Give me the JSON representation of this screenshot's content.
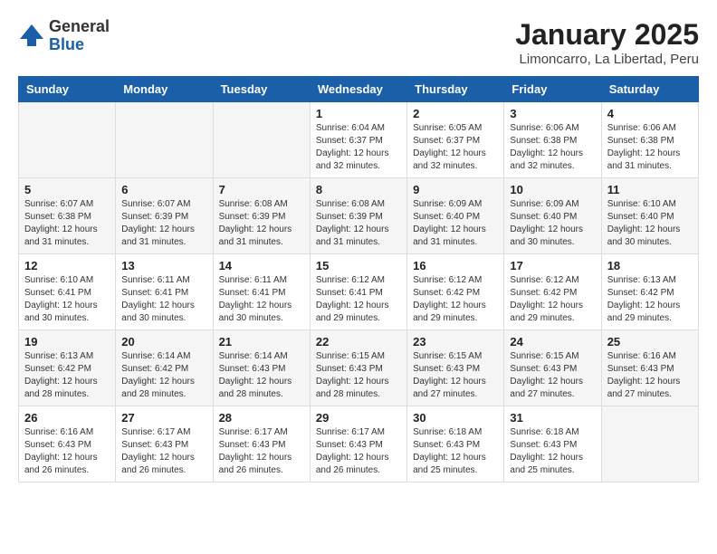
{
  "logo": {
    "general": "General",
    "blue": "Blue"
  },
  "title": "January 2025",
  "subtitle": "Limoncarro, La Libertad, Peru",
  "days": [
    "Sunday",
    "Monday",
    "Tuesday",
    "Wednesday",
    "Thursday",
    "Friday",
    "Saturday"
  ],
  "weeks": [
    [
      {
        "num": "",
        "info": ""
      },
      {
        "num": "",
        "info": ""
      },
      {
        "num": "",
        "info": ""
      },
      {
        "num": "1",
        "info": "Sunrise: 6:04 AM\nSunset: 6:37 PM\nDaylight: 12 hours\nand 32 minutes."
      },
      {
        "num": "2",
        "info": "Sunrise: 6:05 AM\nSunset: 6:37 PM\nDaylight: 12 hours\nand 32 minutes."
      },
      {
        "num": "3",
        "info": "Sunrise: 6:06 AM\nSunset: 6:38 PM\nDaylight: 12 hours\nand 32 minutes."
      },
      {
        "num": "4",
        "info": "Sunrise: 6:06 AM\nSunset: 6:38 PM\nDaylight: 12 hours\nand 31 minutes."
      }
    ],
    [
      {
        "num": "5",
        "info": "Sunrise: 6:07 AM\nSunset: 6:38 PM\nDaylight: 12 hours\nand 31 minutes."
      },
      {
        "num": "6",
        "info": "Sunrise: 6:07 AM\nSunset: 6:39 PM\nDaylight: 12 hours\nand 31 minutes."
      },
      {
        "num": "7",
        "info": "Sunrise: 6:08 AM\nSunset: 6:39 PM\nDaylight: 12 hours\nand 31 minutes."
      },
      {
        "num": "8",
        "info": "Sunrise: 6:08 AM\nSunset: 6:39 PM\nDaylight: 12 hours\nand 31 minutes."
      },
      {
        "num": "9",
        "info": "Sunrise: 6:09 AM\nSunset: 6:40 PM\nDaylight: 12 hours\nand 31 minutes."
      },
      {
        "num": "10",
        "info": "Sunrise: 6:09 AM\nSunset: 6:40 PM\nDaylight: 12 hours\nand 30 minutes."
      },
      {
        "num": "11",
        "info": "Sunrise: 6:10 AM\nSunset: 6:40 PM\nDaylight: 12 hours\nand 30 minutes."
      }
    ],
    [
      {
        "num": "12",
        "info": "Sunrise: 6:10 AM\nSunset: 6:41 PM\nDaylight: 12 hours\nand 30 minutes."
      },
      {
        "num": "13",
        "info": "Sunrise: 6:11 AM\nSunset: 6:41 PM\nDaylight: 12 hours\nand 30 minutes."
      },
      {
        "num": "14",
        "info": "Sunrise: 6:11 AM\nSunset: 6:41 PM\nDaylight: 12 hours\nand 30 minutes."
      },
      {
        "num": "15",
        "info": "Sunrise: 6:12 AM\nSunset: 6:41 PM\nDaylight: 12 hours\nand 29 minutes."
      },
      {
        "num": "16",
        "info": "Sunrise: 6:12 AM\nSunset: 6:42 PM\nDaylight: 12 hours\nand 29 minutes."
      },
      {
        "num": "17",
        "info": "Sunrise: 6:12 AM\nSunset: 6:42 PM\nDaylight: 12 hours\nand 29 minutes."
      },
      {
        "num": "18",
        "info": "Sunrise: 6:13 AM\nSunset: 6:42 PM\nDaylight: 12 hours\nand 29 minutes."
      }
    ],
    [
      {
        "num": "19",
        "info": "Sunrise: 6:13 AM\nSunset: 6:42 PM\nDaylight: 12 hours\nand 28 minutes."
      },
      {
        "num": "20",
        "info": "Sunrise: 6:14 AM\nSunset: 6:42 PM\nDaylight: 12 hours\nand 28 minutes."
      },
      {
        "num": "21",
        "info": "Sunrise: 6:14 AM\nSunset: 6:43 PM\nDaylight: 12 hours\nand 28 minutes."
      },
      {
        "num": "22",
        "info": "Sunrise: 6:15 AM\nSunset: 6:43 PM\nDaylight: 12 hours\nand 28 minutes."
      },
      {
        "num": "23",
        "info": "Sunrise: 6:15 AM\nSunset: 6:43 PM\nDaylight: 12 hours\nand 27 minutes."
      },
      {
        "num": "24",
        "info": "Sunrise: 6:15 AM\nSunset: 6:43 PM\nDaylight: 12 hours\nand 27 minutes."
      },
      {
        "num": "25",
        "info": "Sunrise: 6:16 AM\nSunset: 6:43 PM\nDaylight: 12 hours\nand 27 minutes."
      }
    ],
    [
      {
        "num": "26",
        "info": "Sunrise: 6:16 AM\nSunset: 6:43 PM\nDaylight: 12 hours\nand 26 minutes."
      },
      {
        "num": "27",
        "info": "Sunrise: 6:17 AM\nSunset: 6:43 PM\nDaylight: 12 hours\nand 26 minutes."
      },
      {
        "num": "28",
        "info": "Sunrise: 6:17 AM\nSunset: 6:43 PM\nDaylight: 12 hours\nand 26 minutes."
      },
      {
        "num": "29",
        "info": "Sunrise: 6:17 AM\nSunset: 6:43 PM\nDaylight: 12 hours\nand 26 minutes."
      },
      {
        "num": "30",
        "info": "Sunrise: 6:18 AM\nSunset: 6:43 PM\nDaylight: 12 hours\nand 25 minutes."
      },
      {
        "num": "31",
        "info": "Sunrise: 6:18 AM\nSunset: 6:43 PM\nDaylight: 12 hours\nand 25 minutes."
      },
      {
        "num": "",
        "info": ""
      }
    ]
  ]
}
